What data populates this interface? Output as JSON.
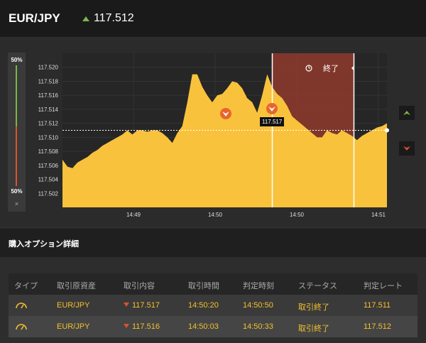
{
  "header": {
    "pair": "EUR/JPY",
    "price": "117.512",
    "direction": "up"
  },
  "meter": {
    "top_label": "50%",
    "bottom_label": "50%",
    "close": "×"
  },
  "expiry": {
    "label": "終了"
  },
  "tooltip": {
    "value": "117.517"
  },
  "chart_data": {
    "type": "area",
    "y_ticks": [
      "117.520",
      "117.518",
      "117.516",
      "117.514",
      "117.512",
      "117.510",
      "117.508",
      "117.506",
      "117.504",
      "117.502"
    ],
    "ylim": [
      117.5,
      117.522
    ],
    "x_ticks": [
      "14:49",
      "14:50",
      "14:50",
      "14:51"
    ],
    "current_rate": 117.512,
    "color": "#f9c23c",
    "expiry_zone_color": "#8b3a2c",
    "values": [
      117.5068,
      117.5058,
      117.5056,
      117.5064,
      117.5068,
      117.5072,
      117.5078,
      117.5082,
      117.5088,
      117.5092,
      117.5096,
      117.51,
      117.5104,
      117.511,
      117.5104,
      117.511,
      117.511,
      117.5108,
      117.511,
      117.511,
      117.5106,
      117.51,
      117.5092,
      117.5106,
      117.5116,
      117.515,
      117.519,
      117.519,
      117.5172,
      117.516,
      117.515,
      117.516,
      117.5162,
      117.517,
      117.518,
      117.5178,
      117.517,
      117.5156,
      117.515,
      117.5135,
      117.516,
      117.519,
      117.5172,
      117.5162,
      117.5156,
      117.5145,
      117.513,
      117.5124,
      117.5118,
      117.5112,
      117.5106,
      117.51,
      117.51,
      117.511,
      117.5106,
      117.5104,
      117.511,
      117.5106,
      117.5102,
      117.5096,
      117.5102,
      117.5106,
      117.511,
      117.5114,
      117.5116,
      117.512
    ],
    "markers": [
      {
        "label": "entry-1",
        "value": 117.516
      },
      {
        "label": "entry-2",
        "value": 117.517
      }
    ]
  },
  "section": {
    "title": "購入オプション詳細"
  },
  "table": {
    "headers": [
      "タイプ",
      "取引原資産",
      "取引内容",
      "取引時間",
      "判定時刻",
      "ステータス",
      "判定レート"
    ],
    "rows": [
      {
        "asset": "EUR/JPY",
        "content": "117.517",
        "time": "14:50:20",
        "judge": "14:50:50",
        "status": "取引終了",
        "rate": "117.511"
      },
      {
        "asset": "EUR/JPY",
        "content": "117.516",
        "time": "14:50:03",
        "judge": "14:50:33",
        "status": "取引終了",
        "rate": "117.512"
      }
    ]
  },
  "colors": {
    "accent": "#f5c02c",
    "up": "#7ab648",
    "down": "#d9532c",
    "background": "#2d2d2d"
  },
  "icons": {
    "type": "gauge-icon",
    "expiry": "clock-icon",
    "buy_up": "up-arrow-icon",
    "buy_down": "down-arrow-icon"
  }
}
